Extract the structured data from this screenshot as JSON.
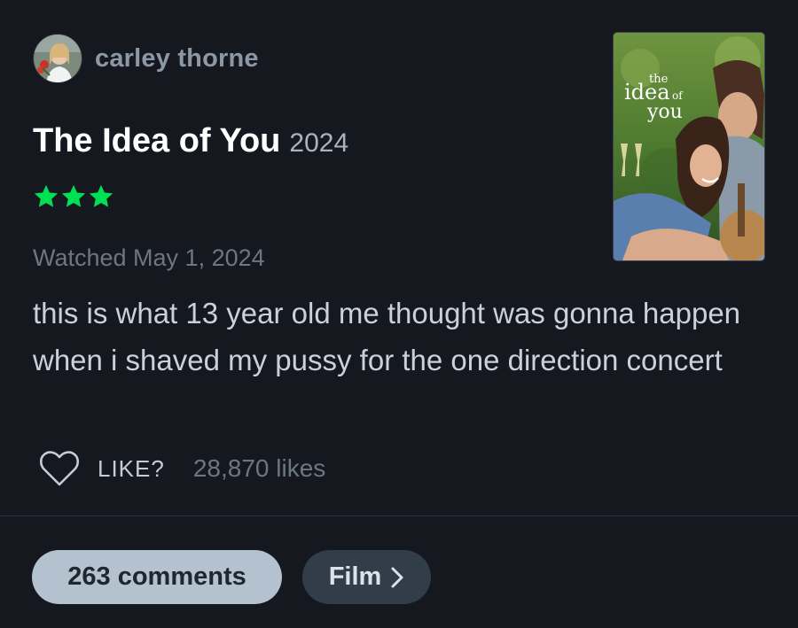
{
  "user": {
    "name": "carley thorne",
    "avatar_icon": "user-avatar"
  },
  "film": {
    "title": "The Idea of You",
    "year": "2024",
    "poster_title_the": "the",
    "poster_title_idea": "idea",
    "poster_title_of": "of",
    "poster_title_you": "you"
  },
  "rating": {
    "stars": 3,
    "max": 5,
    "color": "#00e054"
  },
  "watched": "Watched May 1, 2024",
  "review": {
    "text": "this is what 13 year old me thought was gonna happen when i shaved my pussy for the one direction concert"
  },
  "actions": {
    "like_label": "LIKE?",
    "likes": "28,870 likes",
    "like_icon": "heart-outline-icon"
  },
  "footer": {
    "comments_label": "263 comments",
    "film_label": "Film",
    "film_icon": "chevron-right-icon"
  },
  "colors": {
    "background": "#15181e",
    "accent_green": "#00e054",
    "comments_button": "#b4c1cf",
    "film_button": "#323d4a"
  }
}
